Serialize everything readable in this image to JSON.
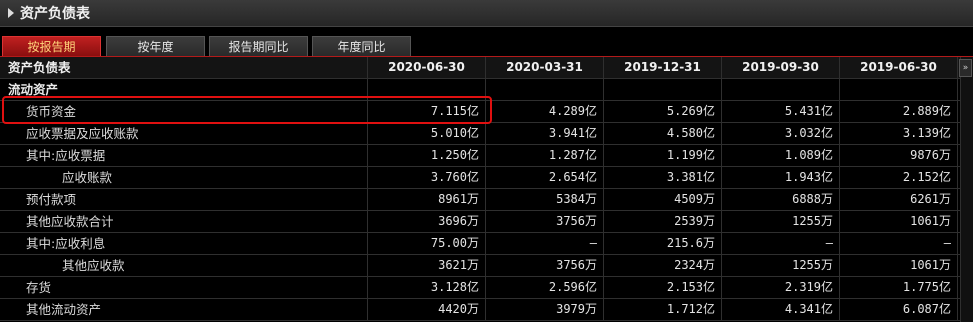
{
  "window": {
    "title": "资产负债表"
  },
  "tabs": [
    "按报告期",
    "按年度",
    "报告期同比",
    "年度同比"
  ],
  "table": {
    "corner_label": "资产负债表",
    "columns": [
      "2020-06-30",
      "2020-03-31",
      "2019-12-31",
      "2019-09-30",
      "2019-06-30"
    ],
    "scroll_right_label": "»",
    "section_label": "流动资产",
    "rows": [
      {
        "label": "货币资金",
        "values": [
          "7.115亿",
          "4.289亿",
          "5.269亿",
          "5.431亿",
          "2.889亿"
        ]
      },
      {
        "label": "应收票据及应收账款",
        "values": [
          "5.010亿",
          "3.941亿",
          "4.580亿",
          "3.032亿",
          "3.139亿"
        ]
      },
      {
        "label": "其中:应收票据",
        "values": [
          "1.250亿",
          "1.287亿",
          "1.199亿",
          "1.089亿",
          "9876万"
        ]
      },
      {
        "label": "应收账款",
        "values": [
          "3.760亿",
          "2.654亿",
          "3.381亿",
          "1.943亿",
          "2.152亿"
        ]
      },
      {
        "label": "预付款项",
        "values": [
          "8961万",
          "5384万",
          "4509万",
          "6888万",
          "6261万"
        ]
      },
      {
        "label": "其他应收款合计",
        "values": [
          "3696万",
          "3756万",
          "2539万",
          "1255万",
          "1061万"
        ]
      },
      {
        "label": "其中:应收利息",
        "values": [
          "75.00万",
          "—",
          "215.6万",
          "—",
          "—"
        ]
      },
      {
        "label": "其他应收款",
        "values": [
          "3621万",
          "3756万",
          "2324万",
          "1255万",
          "1061万"
        ]
      },
      {
        "label": "存货",
        "values": [
          "3.128亿",
          "2.596亿",
          "2.153亿",
          "2.319亿",
          "1.775亿"
        ]
      },
      {
        "label": "其他流动资产",
        "values": [
          "4420万",
          "3979万",
          "1.712亿",
          "4.341亿",
          "6.087亿"
        ]
      }
    ]
  },
  "colors": {
    "accent": "#b31a1a",
    "active_tab_text": "#ffd37a",
    "highlight_box": "#e01010"
  }
}
